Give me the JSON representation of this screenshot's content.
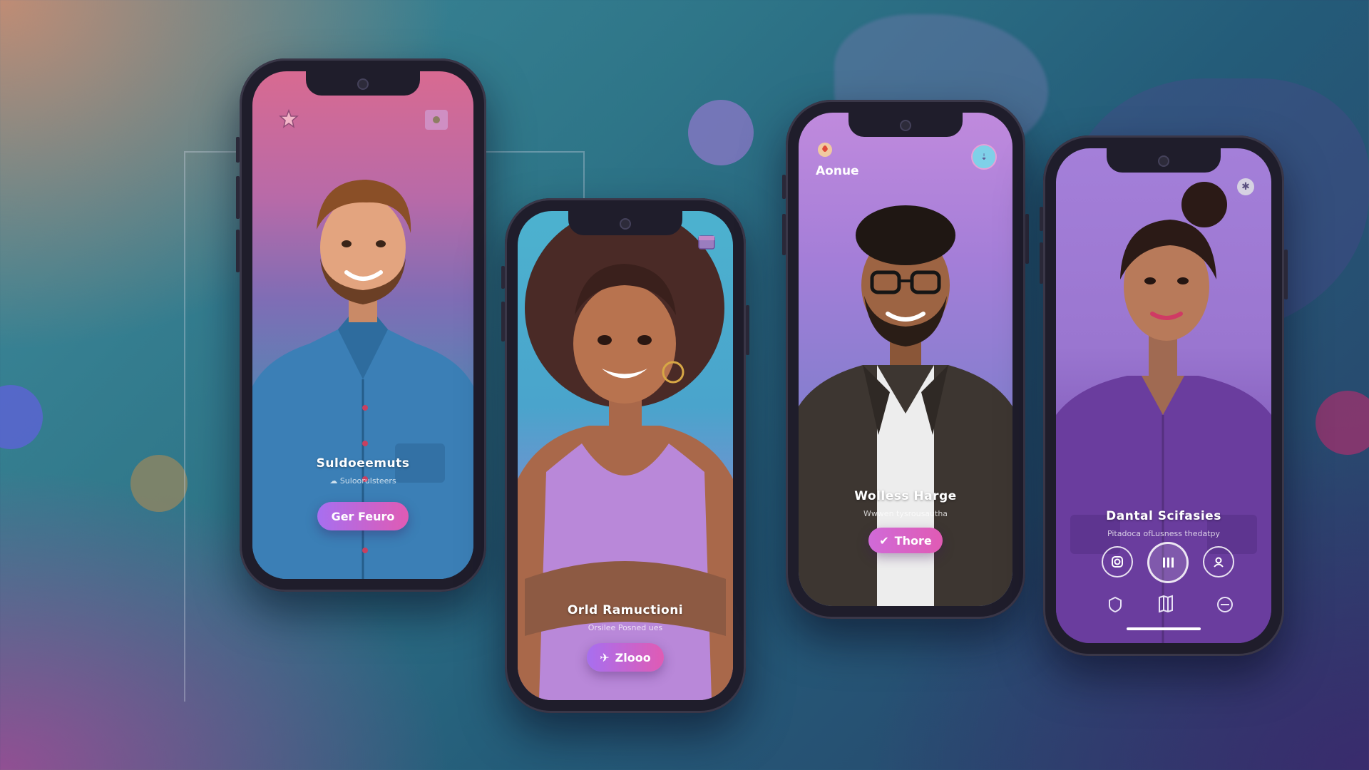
{
  "colors": {
    "accent_gradient_start": "#a76ff0",
    "accent_gradient_end": "#e05bb4",
    "phone_frame": "#1f1d2b",
    "text_primary": "#ffffff"
  },
  "phones": [
    {
      "name": "Suldoeemuts",
      "subtitle": "Suloorulsteers",
      "button_label": "Ger Feuro",
      "top_left_icon": "star-badge-icon",
      "top_right_icon": "square-badge-icon"
    },
    {
      "name": "Orld Ramuctioni",
      "subtitle": "Orsilee Posned ues",
      "button_label": "Zlooo",
      "button_icon": "sparkle-icon",
      "top_right_icon": "calendar-badge-icon"
    },
    {
      "app_label": "Aonue",
      "name": "Wolless Harge",
      "subtitle": "Wwwen tysrousautha",
      "button_label": "Thore",
      "button_icon": "check-icon",
      "top_left_icon": "fire-badge-icon",
      "top_right_icon": "round-badge-icon"
    },
    {
      "name": "Dantal Scifasies",
      "subtitle": "Pitadoca ofLusness thedatpy",
      "controls": [
        "camera-icon",
        "pause-icon",
        "profile-icon"
      ],
      "tabs": [
        "shield-icon",
        "map-icon",
        "menu-icon"
      ],
      "top_right_icon": "settings-icon"
    }
  ]
}
